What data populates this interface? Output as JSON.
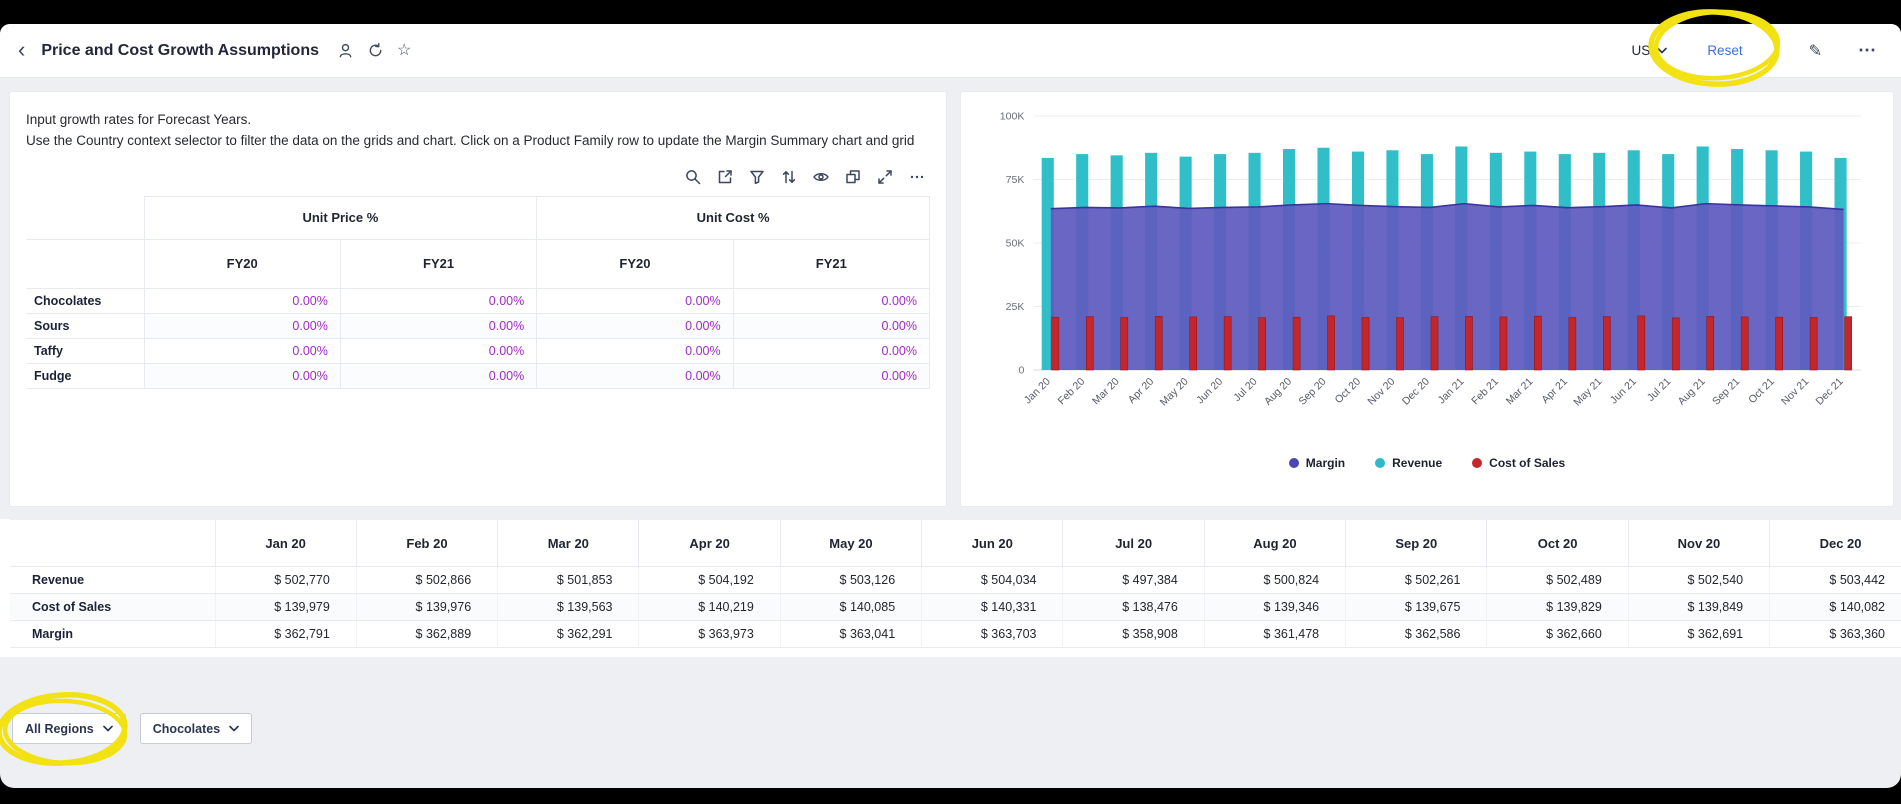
{
  "header": {
    "back_glyph": "‹",
    "title": "Price and Cost Growth Assumptions",
    "star_glyph": "☆",
    "edit_glyph": "✎",
    "more_glyph": "⋯",
    "country_selector": {
      "value": "US"
    },
    "reset_label": "Reset"
  },
  "instructions": {
    "line1": "Input growth rates for Forecast Years.",
    "line2": "Use the Country context selector to filter the data on the grids and chart. Click on a Product Family row to update the Margin Summary chart and grid"
  },
  "growth_grid": {
    "value_color": "#a12bc4",
    "column_groups": [
      "Unit Price %",
      "Unit Cost %"
    ],
    "sub_columns": [
      "FY20",
      "FY21",
      "FY20",
      "FY21"
    ],
    "rows": [
      {
        "label": "Chocolates",
        "values": [
          "0.00%",
          "0.00%",
          "0.00%",
          "0.00%"
        ]
      },
      {
        "label": "Sours",
        "values": [
          "0.00%",
          "0.00%",
          "0.00%",
          "0.00%"
        ]
      },
      {
        "label": "Taffy",
        "values": [
          "0.00%",
          "0.00%",
          "0.00%",
          "0.00%"
        ]
      },
      {
        "label": "Fudge",
        "values": [
          "0.00%",
          "0.00%",
          "0.00%",
          "0.00%"
        ]
      }
    ]
  },
  "chart_data": {
    "type": "combo (area + bar)",
    "x": [
      "Jan 20",
      "Feb 20",
      "Mar 20",
      "Apr 20",
      "May 20",
      "Jun 20",
      "Jul 20",
      "Aug 20",
      "Sep 20",
      "Oct 20",
      "Nov 20",
      "Dec 20",
      "Jan 21",
      "Feb 21",
      "Mar 21",
      "Apr 21",
      "May 21",
      "Jun 21",
      "Jul 21",
      "Aug 21",
      "Sep 21",
      "Oct 21",
      "Nov 21",
      "Dec 21"
    ],
    "ylim": [
      0,
      100000
    ],
    "ytick_values": [
      0,
      25000,
      50000,
      75000,
      100000
    ],
    "ytick_labels": [
      "0",
      "25K",
      "50K",
      "75K",
      "100K"
    ],
    "grid": true,
    "legend_position": "bottom",
    "series": [
      {
        "name": "Margin",
        "type": "area",
        "color": "#5f5abe",
        "line_color": "#39349c",
        "legend_color": "#4b46b2",
        "values": [
          63500,
          64000,
          63800,
          64500,
          63600,
          64000,
          64200,
          65000,
          65500,
          64800,
          64300,
          64000,
          65500,
          64200,
          64800,
          63900,
          64300,
          65000,
          63800,
          65500,
          65000,
          64600,
          64200,
          63200
        ]
      },
      {
        "name": "Revenue",
        "type": "bar",
        "color": "#30bfc9",
        "legend_color": "#2fb9c9",
        "values": [
          83500,
          85000,
          84500,
          85500,
          84000,
          85000,
          85500,
          87000,
          87500,
          86000,
          86500,
          85000,
          88000,
          85500,
          86000,
          85000,
          85500,
          86500,
          85000,
          88000,
          87000,
          86500,
          86000,
          83500
        ]
      },
      {
        "name": "Cost of Sales",
        "type": "bar",
        "color": "#c5262c",
        "legend_color": "#c5262c",
        "values": [
          20800,
          21000,
          20700,
          21100,
          20900,
          21000,
          20600,
          20800,
          21300,
          20700,
          20600,
          21000,
          21100,
          20900,
          21200,
          20700,
          21000,
          21300,
          20500,
          21100,
          20900,
          20800,
          20700,
          21000
        ]
      }
    ]
  },
  "summary_grid": {
    "columns": [
      "Jan 20",
      "Feb 20",
      "Mar 20",
      "Apr 20",
      "May 20",
      "Jun 20",
      "Jul 20",
      "Aug 20",
      "Sep 20",
      "Oct 20",
      "Nov 20",
      "Dec 20"
    ],
    "rows": [
      {
        "label": "Revenue",
        "values": [
          "$ 502,770",
          "$ 502,866",
          "$ 501,853",
          "$ 504,192",
          "$ 503,126",
          "$ 504,034",
          "$ 497,384",
          "$ 500,824",
          "$ 502,261",
          "$ 502,489",
          "$ 502,540",
          "$ 503,442"
        ]
      },
      {
        "label": "Cost of Sales",
        "values": [
          "$ 139,979",
          "$ 139,976",
          "$ 139,563",
          "$ 140,219",
          "$ 140,085",
          "$ 140,331",
          "$ 138,476",
          "$ 139,346",
          "$ 139,675",
          "$ 139,829",
          "$ 139,849",
          "$ 140,082"
        ]
      },
      {
        "label": "Margin",
        "values": [
          "$ 362,791",
          "$ 362,889",
          "$ 362,291",
          "$ 363,973",
          "$ 363,041",
          "$ 363,703",
          "$ 358,908",
          "$ 361,478",
          "$ 362,586",
          "$ 362,660",
          "$ 362,691",
          "$ 363,360"
        ]
      }
    ]
  },
  "footer_selectors": [
    {
      "label": "All Regions"
    },
    {
      "label": "Chocolates"
    }
  ],
  "annotation_color": "#f2e214"
}
